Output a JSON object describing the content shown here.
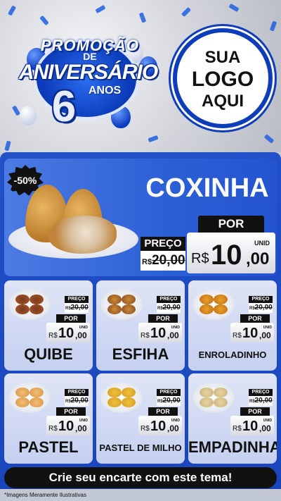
{
  "header": {
    "promo_top": "PROMOÇÃO",
    "promo_de": "DE",
    "promo_main": "ANIVERSÁRIO",
    "promo_number": "6",
    "promo_anos": "ANOS",
    "logo_line1": "SUA",
    "logo_line2": "LOGO",
    "logo_line3": "AQUI"
  },
  "featured": {
    "badge": "-50%",
    "name": "COXINHA",
    "old_label": "PREÇO",
    "old_currency": "R$",
    "old_amount": "20,00",
    "por_label": "POR",
    "currency": "R$",
    "amount": "10",
    "cents": ",00",
    "unit": "UNID"
  },
  "products": [
    {
      "name": "QUIBE",
      "old_label": "PREÇO",
      "old_currency": "R$",
      "old_amount": "20,00",
      "por_label": "POR",
      "currency": "R$",
      "amount": "10",
      "cents": ",00",
      "unit": "UNID"
    },
    {
      "name": "ESFIHA",
      "old_label": "PREÇO",
      "old_currency": "R$",
      "old_amount": "20,00",
      "por_label": "POR",
      "currency": "R$",
      "amount": "10",
      "cents": ",00",
      "unit": "UNID"
    },
    {
      "name": "ENROLADINHO",
      "old_label": "PREÇO",
      "old_currency": "R$",
      "old_amount": "20,00",
      "por_label": "POR",
      "currency": "R$",
      "amount": "10",
      "cents": ",00",
      "unit": "UNID"
    },
    {
      "name": "PASTEL",
      "old_label": "PREÇO",
      "old_currency": "R$",
      "old_amount": "20,00",
      "por_label": "POR",
      "currency": "R$",
      "amount": "10",
      "cents": ",00",
      "unit": "UNID"
    },
    {
      "name": "PASTEL DE MILHO",
      "old_label": "PREÇO",
      "old_currency": "R$",
      "old_amount": "20,00",
      "por_label": "POR",
      "currency": "R$",
      "amount": "10",
      "cents": ",00",
      "unit": "UNID"
    },
    {
      "name": "EMPADINHA",
      "old_label": "PREÇO",
      "old_currency": "R$",
      "old_amount": "20,00",
      "por_label": "POR",
      "currency": "R$",
      "amount": "10",
      "cents": ",00",
      "unit": "UNID"
    }
  ],
  "cta": "Crie seu encarte com este tema!",
  "footnote": "*Imagens Meramente Ilustrativas",
  "colors": {
    "primary_blue": "#2150c8",
    "black": "#111111",
    "white": "#ffffff"
  }
}
